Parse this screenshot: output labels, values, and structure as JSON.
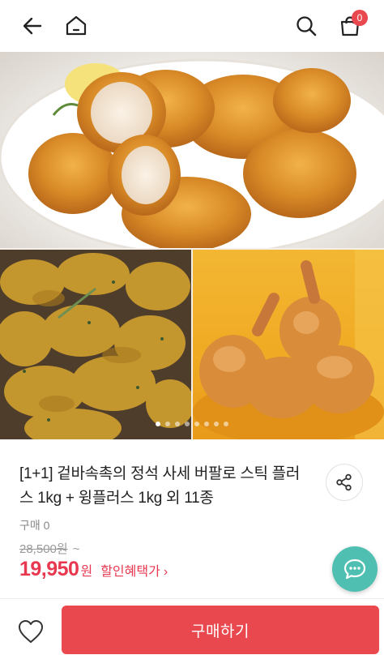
{
  "header": {
    "cart_count": "0"
  },
  "gallery": {
    "slide_count": 8,
    "active_index": 0
  },
  "product": {
    "title": "[1+1] 겉바속촉의 정석 사세 버팔로 스틱 플러스 1kg + 윙플러스 1kg 외 11종",
    "purchases": "구매 0",
    "original_price": "28,500원",
    "original_suffix": "~",
    "sale_price": "19,950",
    "sale_unit": "원",
    "benefit_label": "할인혜택가",
    "benefit_chevron": "›"
  },
  "bottom_bar": {
    "buy_label": "구매하기"
  },
  "colors": {
    "accent": "#e8484e",
    "price": "#e8384f",
    "chat": "#4fbfb1"
  }
}
